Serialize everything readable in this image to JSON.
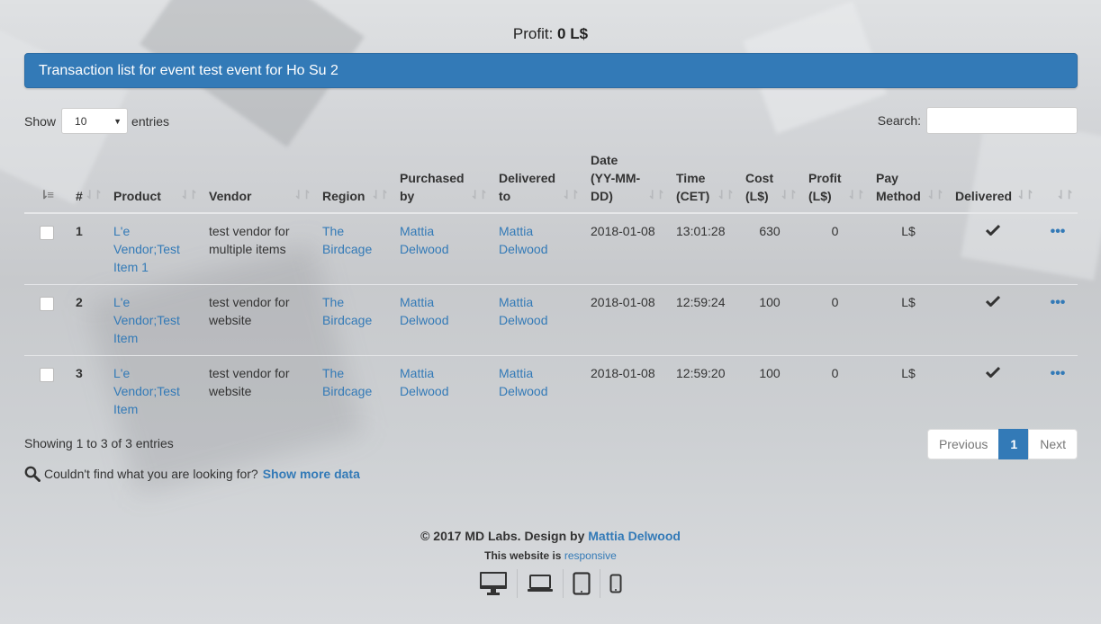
{
  "profit": {
    "label": "Profit:",
    "value": "0 L$"
  },
  "panel": {
    "title": "Transaction list for event test event for Ho Su 2"
  },
  "length": {
    "show": "Show",
    "value": "10",
    "entries": "entries"
  },
  "search": {
    "label": "Search:",
    "value": ""
  },
  "columns": [
    "#",
    "Product",
    "Vendor",
    "Region",
    "Purchased by",
    "Delivered to",
    "Date (YY-MM-DD)",
    "Time (CET)",
    "Cost (L$)",
    "Profit (L$)",
    "Pay Method",
    "Delivered"
  ],
  "rows": [
    {
      "num": "1",
      "product": "L'e Vendor;Test Item 1",
      "vendor": "test vendor for multiple items",
      "region": "The Birdcage",
      "purchased_by": "Mattia Delwood",
      "delivered_to": "Mattia Delwood",
      "date": "2018-01-08",
      "time": "13:01:28",
      "cost": "630",
      "profit": "0",
      "pay": "L$"
    },
    {
      "num": "2",
      "product": "L'e Vendor;Test Item",
      "vendor": "test vendor for website",
      "region": "The Birdcage",
      "purchased_by": "Mattia Delwood",
      "delivered_to": "Mattia Delwood",
      "date": "2018-01-08",
      "time": "12:59:24",
      "cost": "100",
      "profit": "0",
      "pay": "L$"
    },
    {
      "num": "3",
      "product": "L'e Vendor;Test Item",
      "vendor": "test vendor for website",
      "region": "The Birdcage",
      "purchased_by": "Mattia Delwood",
      "delivered_to": "Mattia Delwood",
      "date": "2018-01-08",
      "time": "12:59:20",
      "cost": "100",
      "profit": "0",
      "pay": "L$"
    }
  ],
  "info": "Showing 1 to 3 of 3 entries",
  "pagination": {
    "previous": "Previous",
    "page": "1",
    "next": "Next"
  },
  "more": {
    "text": "Couldn't find what you are looking for?",
    "link": "Show more data"
  },
  "footer": {
    "copy_prefix": "2017 MD Labs. Design by",
    "designer": "Mattia Delwood",
    "responsive_prefix": "This website is",
    "responsive_link": "responsive"
  },
  "icons": {
    "sort": "sort-icon",
    "check": "check-icon",
    "more": "ellipsis-icon",
    "search": "magnifier-icon",
    "devices": [
      "desktop-icon",
      "laptop-icon",
      "tablet-icon",
      "phone-icon"
    ]
  },
  "colors": {
    "primary": "#337ab7"
  }
}
